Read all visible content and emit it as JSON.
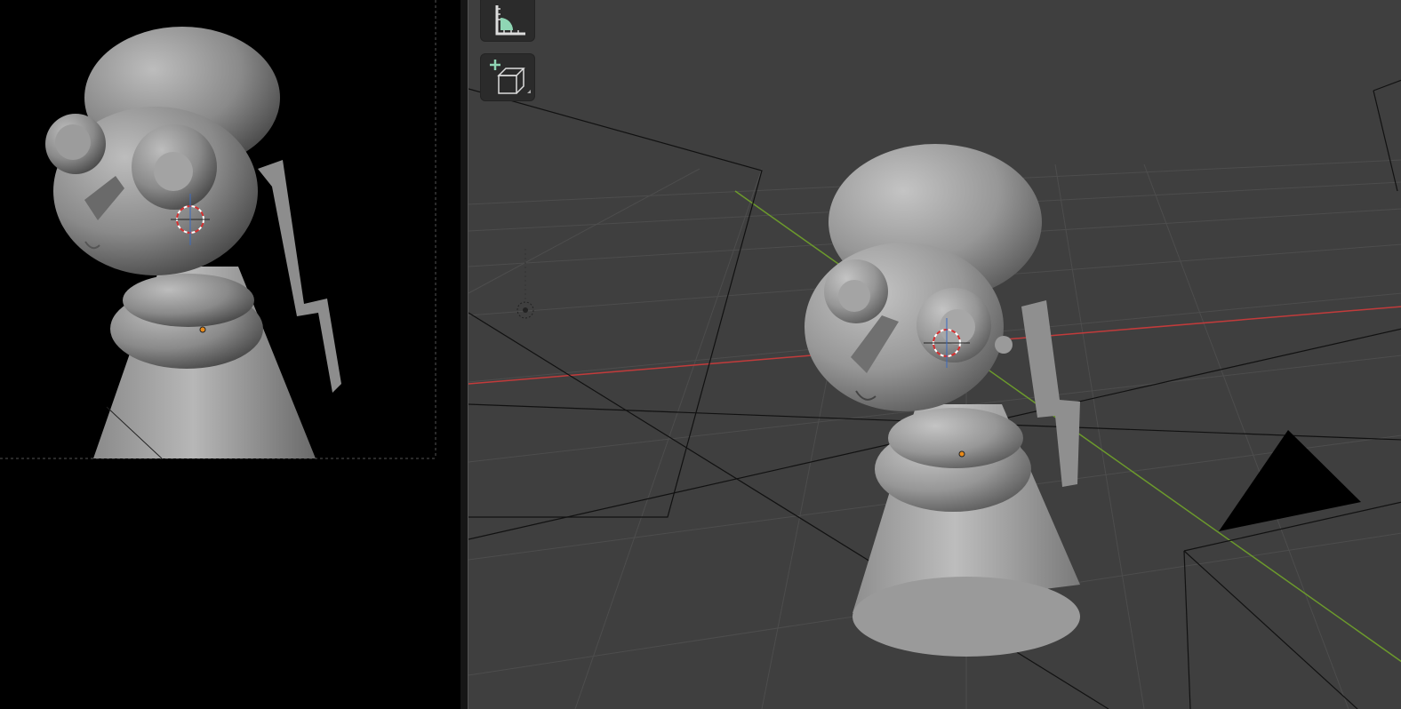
{
  "app": "Blender",
  "layout": {
    "left_area": "camera-preview",
    "right_area": "3d-viewport"
  },
  "toolbar": {
    "tools": [
      {
        "name": "measure",
        "icon": "measure-ruler-icon"
      },
      {
        "name": "add-cube",
        "icon": "add-cube-icon"
      }
    ]
  },
  "colors": {
    "viewport_bg": "#3f3f3f",
    "camera_bg": "#000000",
    "grid_line": "#555555",
    "x_axis": "#c23b3b",
    "y_axis": "#6c9a2c",
    "tool_accent": "#8fd6b4",
    "origin_dot": "#e88a1a"
  }
}
